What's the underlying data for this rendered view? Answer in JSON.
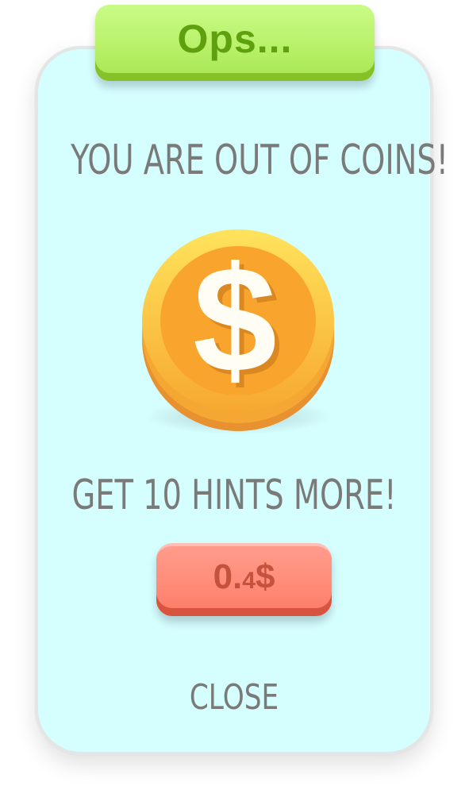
{
  "dialog": {
    "title": "Ops...",
    "message": "YOU ARE OUT OF COINS!",
    "offer": "GET 10 HINTS MORE!",
    "price": {
      "prefix": "0.",
      "digit": "4",
      "currency": "$"
    },
    "close_label": "CLOSE"
  },
  "icons": {
    "coin": "dollar-coin-icon"
  },
  "colors": {
    "card_background": "#d5feff",
    "banner": "#b8f169",
    "banner_text": "#5fa00f",
    "button": "#ff8a76",
    "button_text": "#c4523c",
    "text_gray": "#7a7a78",
    "coin_gold": "#f9b233"
  }
}
